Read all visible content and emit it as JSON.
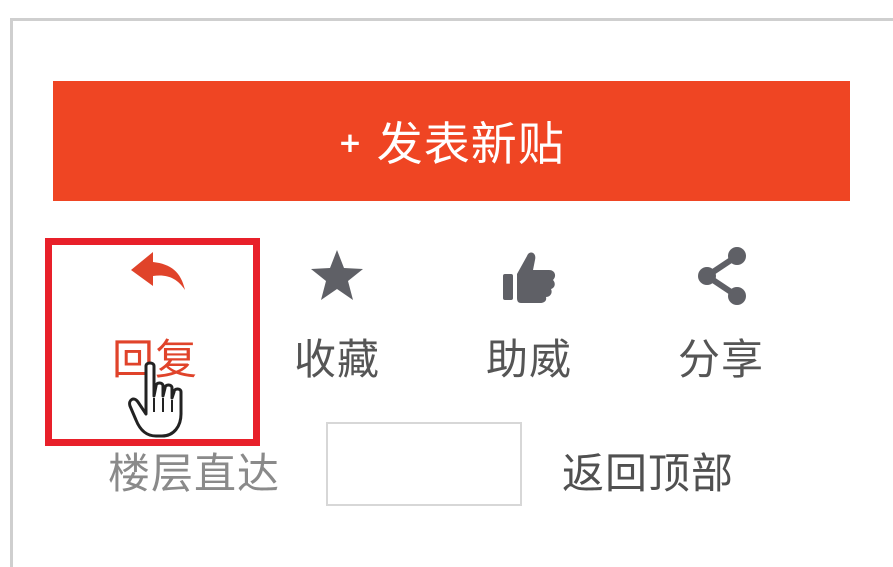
{
  "post_button": {
    "plus": "+",
    "label": "发表新贴"
  },
  "actions": [
    {
      "label": "回复",
      "icon": "reply-arrow-icon",
      "color": "#e0432a"
    },
    {
      "label": "收藏",
      "icon": "star-icon",
      "color": "#5f6066"
    },
    {
      "label": "助威",
      "icon": "thumbs-up-icon",
      "color": "#5f6066"
    },
    {
      "label": "分享",
      "icon": "share-icon",
      "color": "#5f6066"
    }
  ],
  "floor_jump": {
    "label": "楼层直达",
    "value": ""
  },
  "back_to_top": {
    "label": "返回顶部"
  },
  "colors": {
    "accent": "#ef4523",
    "highlight": "#e8202a",
    "text": "#555555"
  }
}
